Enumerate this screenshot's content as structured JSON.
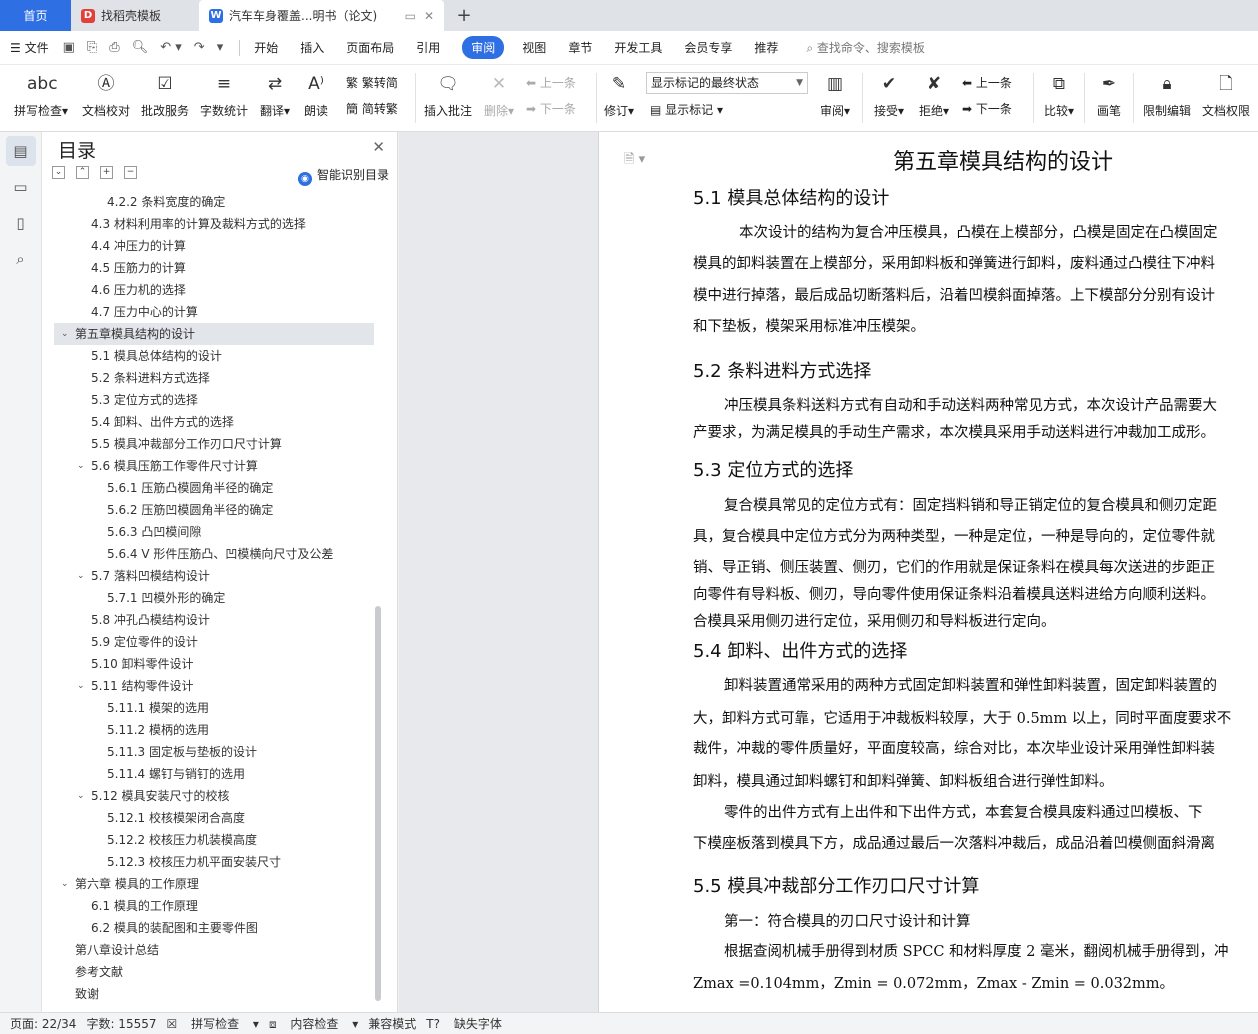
{
  "tabs": {
    "home": "首页",
    "template": "找稻壳模板",
    "doc": "汽车车身覆盖...明书（论文)",
    "add": "+"
  },
  "menu": {
    "file": "文件",
    "items": [
      "开始",
      "插入",
      "页面布局",
      "引用",
      "审阅",
      "视图",
      "章节",
      "开发工具",
      "会员专享",
      "推荐"
    ],
    "search": "查找命令、搜索模板"
  },
  "ribbon": {
    "spell": "拼写检查",
    "proof": "文档校对",
    "batch": "批改服务",
    "count": "字数统计",
    "translate": "翻译",
    "read": "朗读",
    "trad": "繁转简",
    "simp": "简转繁",
    "insert_comment": "插入批注",
    "delete": "删除",
    "prev": "上一条",
    "next": "下一条",
    "revise": "修订",
    "markup_mode": "显示标记的最终状态",
    "show_markup": "显示标记",
    "review": "审阅",
    "accept": "接受",
    "reject": "拒绝",
    "prev2": "上一条",
    "next2": "下一条",
    "compare": "比较",
    "draw": "画笔",
    "restrict": "限制编辑",
    "perm": "文档权限"
  },
  "toc": {
    "title": "目录",
    "smart": "智能识别目录",
    "items": [
      {
        "t": "4.2.2 条料宽度的确定",
        "lvl": 3,
        "arrow": ""
      },
      {
        "t": "4.3 材料利用率的计算及裁料方式的选择",
        "lvl": 2,
        "arrow": ""
      },
      {
        "t": "4.4 冲压力的计算",
        "lvl": 2,
        "arrow": ""
      },
      {
        "t": "4.5 压筋力的计算",
        "lvl": 2,
        "arrow": ""
      },
      {
        "t": "4.6 压力机的选择",
        "lvl": 2,
        "arrow": ""
      },
      {
        "t": "4.7 压力中心的计算",
        "lvl": 2,
        "arrow": ""
      },
      {
        "t": "第五章模具结构的设计",
        "lvl": 1,
        "arrow": "⌄",
        "sel": true
      },
      {
        "t": "5.1 模具总体结构的设计",
        "lvl": 2,
        "arrow": ""
      },
      {
        "t": "5.2 条料进料方式选择",
        "lvl": 2,
        "arrow": ""
      },
      {
        "t": "5.3 定位方式的选择",
        "lvl": 2,
        "arrow": ""
      },
      {
        "t": "5.4 卸料、出件方式的选择",
        "lvl": 2,
        "arrow": ""
      },
      {
        "t": "5.5 模具冲裁部分工作刃口尺寸计算",
        "lvl": 2,
        "arrow": ""
      },
      {
        "t": "5.6 模具压筋工作零件尺寸计算",
        "lvl": 2,
        "arrow": "⌄"
      },
      {
        "t": "5.6.1 压筋凸模圆角半径的确定",
        "lvl": 3,
        "arrow": ""
      },
      {
        "t": "5.6.2 压筋凹模圆角半径的确定",
        "lvl": 3,
        "arrow": ""
      },
      {
        "t": "5.6.3 凸凹模间隙",
        "lvl": 3,
        "arrow": ""
      },
      {
        "t": "5.6.4 V 形件压筋凸、凹模横向尺寸及公差",
        "lvl": 3,
        "arrow": ""
      },
      {
        "t": "5.7 落料凹模结构设计",
        "lvl": 2,
        "arrow": "⌄"
      },
      {
        "t": "5.7.1 凹模外形的确定",
        "lvl": 3,
        "arrow": ""
      },
      {
        "t": "5.8 冲孔凸模结构设计",
        "lvl": 2,
        "arrow": ""
      },
      {
        "t": "5.9 定位零件的设计",
        "lvl": 2,
        "arrow": ""
      },
      {
        "t": "5.10 卸料零件设计",
        "lvl": 2,
        "arrow": ""
      },
      {
        "t": "5.11 结构零件设计",
        "lvl": 2,
        "arrow": "⌄"
      },
      {
        "t": "5.11.1 模架的选用",
        "lvl": 3,
        "arrow": ""
      },
      {
        "t": "5.11.2 模柄的选用",
        "lvl": 3,
        "arrow": ""
      },
      {
        "t": "5.11.3 固定板与垫板的设计",
        "lvl": 3,
        "arrow": ""
      },
      {
        "t": "5.11.4 螺钉与销钉的选用",
        "lvl": 3,
        "arrow": ""
      },
      {
        "t": "5.12 模具安装尺寸的校核",
        "lvl": 2,
        "arrow": "⌄"
      },
      {
        "t": "5.12.1 校核模架闭合高度",
        "lvl": 3,
        "arrow": ""
      },
      {
        "t": "5.12.2 校核压力机装模高度",
        "lvl": 3,
        "arrow": ""
      },
      {
        "t": "5.12.3 校核压力机平面安装尺寸",
        "lvl": 3,
        "arrow": ""
      },
      {
        "t": "第六章 模具的工作原理",
        "lvl": 1,
        "arrow": "⌄"
      },
      {
        "t": "6.1 模具的工作原理",
        "lvl": 2,
        "arrow": ""
      },
      {
        "t": "6.2 模具的装配图和主要零件图",
        "lvl": 2,
        "arrow": ""
      },
      {
        "t": "第八章设计总结",
        "lvl": 1,
        "arrow": ""
      },
      {
        "t": "参考文献",
        "lvl": 1,
        "arrow": ""
      },
      {
        "t": "致谢",
        "lvl": 1,
        "arrow": ""
      }
    ]
  },
  "doc": {
    "chapter": "第五章模具结构的设计",
    "blocks": [
      {
        "k": "h2",
        "t": "5.1 模具总体结构的设计"
      },
      {
        "k": "ln",
        "t": "本次设计的结构为复合冲压模具，凸模在上模部分，凸模是固定在凸模固定"
      },
      {
        "k": "ln",
        "t": "模具的卸料装置在上模部分，采用卸料板和弹簧进行卸料，废料通过凸模往下冲料"
      },
      {
        "k": "ln",
        "t": "模中进行掉落，最后成品切断落料后，沿着凹模斜面掉落。上下模部分分别有设计"
      },
      {
        "k": "ln",
        "t": "和下垫板，模架采用标准冲压模架。"
      },
      {
        "k": "h2",
        "t": "5.2 条料进料方式选择"
      },
      {
        "k": "ln",
        "t": "冲压模具条料送料方式有自动和手动送料两种常见方式，本次设计产品需要大"
      },
      {
        "k": "ln",
        "t": "产要求，为满足模具的手动生产需求，本次模具采用手动送料进行冲裁加工成形。"
      },
      {
        "k": "h2",
        "t": "5.3 定位方式的选择"
      },
      {
        "k": "ln",
        "t": "复合模具常见的定位方式有：固定挡料销和导正销定位的复合模具和侧刃定距"
      },
      {
        "k": "ln",
        "t": "具，复合模具中定位方式分为两种类型，一种是定位，一种是导向的，定位零件就"
      },
      {
        "k": "ln",
        "t": "销、导正销、侧压装置、侧刃，它们的作用就是保证条料在模具每次送进的步距正"
      },
      {
        "k": "ln",
        "t": "向零件有导料板、侧刃，导向零件使用保证条料沿着模具送料进给方向顺利送料。"
      },
      {
        "k": "ln",
        "t": "合模具采用侧刃进行定位，采用侧刃和导料板进行定向。"
      },
      {
        "k": "h2",
        "t": "5.4 卸料、出件方式的选择"
      },
      {
        "k": "ln",
        "t": "卸料装置通常采用的两种方式固定卸料装置和弹性卸料装置，固定卸料装置的"
      },
      {
        "k": "ln",
        "t": "大，卸料方式可靠，它适用于冲裁板料较厚，大于 0.5mm 以上，同时平面度要求不"
      },
      {
        "k": "ln",
        "t": "裁件，冲裁的零件质量好，平面度较高，综合对比，本次毕业设计采用弹性卸料装"
      },
      {
        "k": "ln",
        "t": "卸料，模具通过卸料螺钉和卸料弹簧、卸料板组合进行弹性卸料。"
      },
      {
        "k": "ln",
        "t": "零件的出件方式有上出件和下出件方式，本套复合模具废料通过凹模板、下"
      },
      {
        "k": "ln",
        "t": "下模座板落到模具下方，成品通过最后一次落料冲裁后，成品沿着凹模侧面斜滑离"
      },
      {
        "k": "h2",
        "t": "5.5 模具冲裁部分工作刃口尺寸计算"
      },
      {
        "k": "ln",
        "t": "第一：符合模具的刃口尺寸设计和计算"
      },
      {
        "k": "ln",
        "t": "根据查阅机械手册得到材质 SPCC 和材料厚度 2 毫米，翻阅机械手册得到，冲"
      },
      {
        "k": "ln",
        "t": "Zmax =0.104mm，Zmin = 0.072mm，Zmax - Zmin = 0.032mm。"
      }
    ]
  },
  "status": {
    "page": "页面: 22/34",
    "words": "字数: 15557",
    "spell": "拼写检查",
    "content": "内容检查",
    "compat": "兼容模式",
    "font": "缺失字体"
  }
}
